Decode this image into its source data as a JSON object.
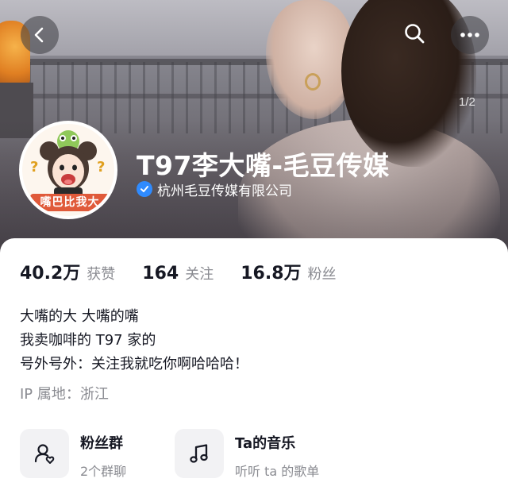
{
  "header": {
    "page_indicator": "1/2",
    "back_icon": "chevron-left-icon",
    "search_icon": "search-icon",
    "more_icon": "more-horizontal-icon"
  },
  "profile": {
    "avatar_caption": "嘴巴比我大",
    "name": "T97李大嘴-毛豆传媒",
    "verified_org": "杭州毛豆传媒有限公司",
    "verified_color": "#2f8bff"
  },
  "stats": [
    {
      "value": "40.2万",
      "label": "获赞"
    },
    {
      "value": "164",
      "label": "关注"
    },
    {
      "value": "16.8万",
      "label": "粉丝"
    }
  ],
  "bio": {
    "lines": [
      "大嘴的大 大嘴的嘴",
      "我卖咖啡的 T97 家的",
      "号外号外：关注我就吃你啊哈哈哈！"
    ],
    "ip_location": "IP 属地：浙江"
  },
  "features": {
    "fans_group": {
      "title": "粉丝群",
      "subtitle": "2个群聊",
      "icon": "group-icon"
    },
    "music": {
      "title": "Ta的音乐",
      "subtitle": "听听 ta 的歌单",
      "icon": "music-note-icon"
    }
  }
}
